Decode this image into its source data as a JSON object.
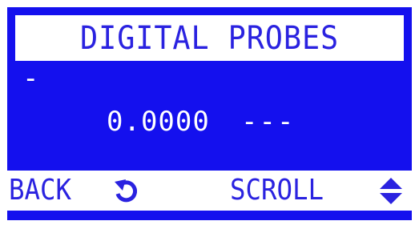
{
  "screen": {
    "title": "DIGITAL PROBES",
    "probe": {
      "marker": "-",
      "value": "0.0000",
      "unit": "---"
    },
    "footer": {
      "back_label": "BACK",
      "back_icon": "rotate-back-icon",
      "scroll_label": "SCROLL",
      "scroll_icon": "up-down-arrows-icon"
    }
  },
  "colors": {
    "background": "#1410ee",
    "text_on_white": "#2a22e0",
    "text_on_blue": "#ffffff"
  }
}
